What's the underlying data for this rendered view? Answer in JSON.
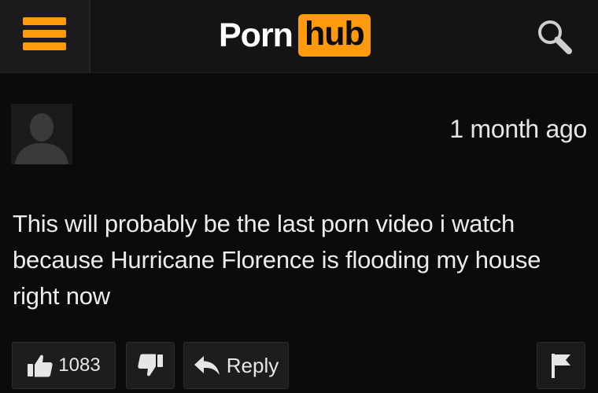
{
  "header": {
    "logo": {
      "word1": "Porn",
      "word2": "hub"
    },
    "icons": {
      "menu": "hamburger-menu-icon",
      "search": "search-icon"
    },
    "colors": {
      "accent": "#ff9a0d",
      "background": "#0b0b0b",
      "header_background": "#141414"
    }
  },
  "comment": {
    "avatar_icon": "user-silhouette-icon",
    "timestamp": "1 month ago",
    "text": "This will probably be the last porn video i watch because Hurricane Florence is flooding my house right now"
  },
  "actions": {
    "like_icon": "thumbs-up-icon",
    "like_count": "1083",
    "dislike_icon": "thumbs-down-icon",
    "reply_icon": "reply-arrow-icon",
    "reply_label": "Reply",
    "flag_icon": "flag-icon"
  }
}
